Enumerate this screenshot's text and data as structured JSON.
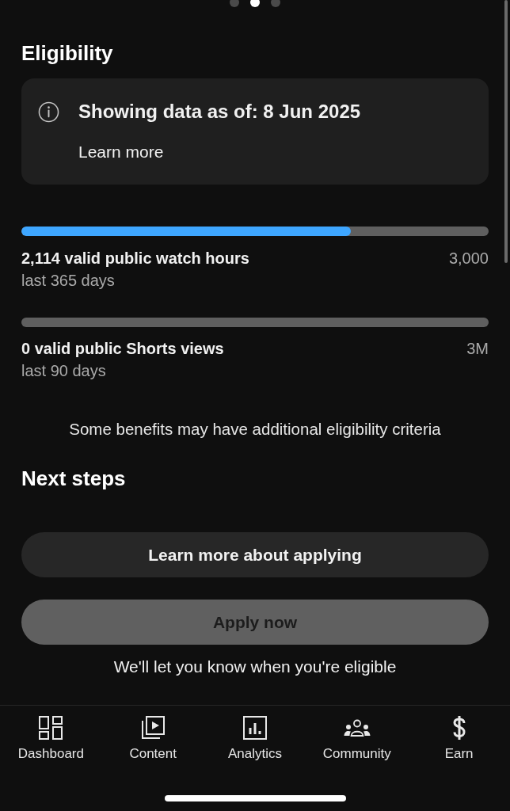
{
  "page_dots": [
    {
      "selected": false
    },
    {
      "selected": true
    },
    {
      "selected": false
    }
  ],
  "eligibility": {
    "title": "Eligibility",
    "notice": {
      "text": "Showing data as of: 8 Jun 2025",
      "link": "Learn more"
    },
    "metrics": [
      {
        "label": "2,114 valid public watch hours",
        "target": "3,000",
        "period": "last 365 days",
        "level": 0.705
      },
      {
        "label": "0 valid public Shorts views",
        "target": "3M",
        "period": "last 90 days",
        "level": 0
      }
    ],
    "note": "Some benefits may have additional eligibility criteria"
  },
  "next_steps": {
    "title": "Next steps",
    "buttons": [
      {
        "label": "Learn more about applying",
        "disabled": false
      },
      {
        "label": "Apply now",
        "disabled": true
      }
    ],
    "hint": "We'll let you know when you're eligible"
  },
  "bottom_nav": {
    "items": [
      {
        "label": "Dashboard"
      },
      {
        "label": "Content"
      },
      {
        "label": "Analytics"
      },
      {
        "label": "Community"
      },
      {
        "label": "Earn"
      }
    ]
  }
}
